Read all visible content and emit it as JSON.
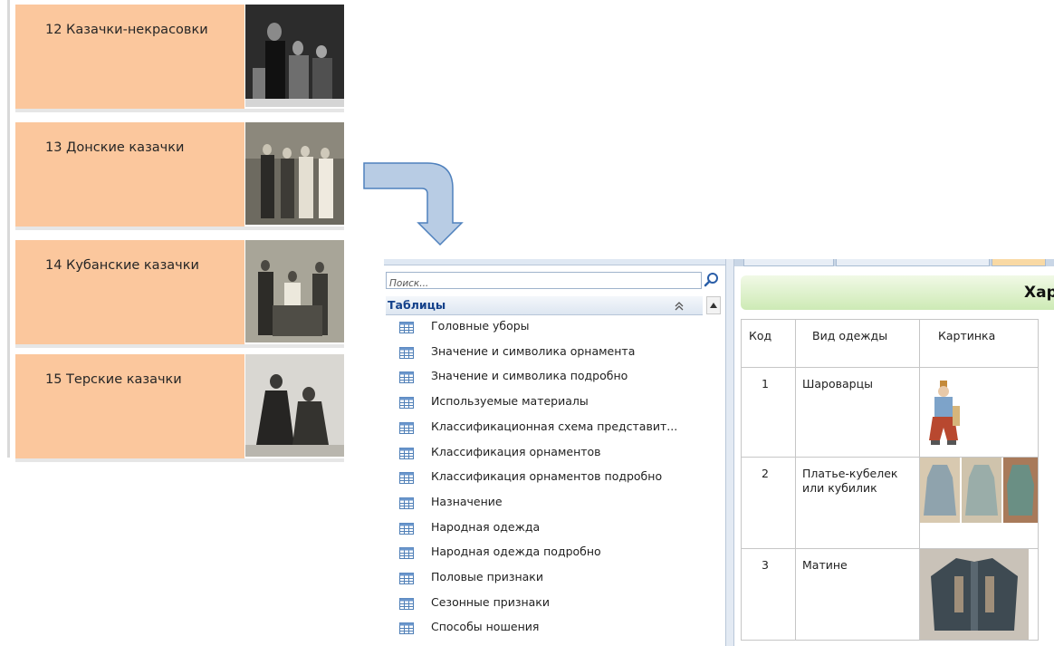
{
  "records": [
    {
      "label": "12 Казачки-некрасовки"
    },
    {
      "label": "13 Донские казачки"
    },
    {
      "label": "14 Кубанские казачки"
    },
    {
      "label": "15 Терские казачки"
    }
  ],
  "nav": {
    "search_placeholder": "Поиск...",
    "group_title": "Таблицы",
    "items": [
      "Головные уборы",
      "Значение и символика орнамента",
      "Значение и символика подробно",
      "Используемые материалы",
      "Классификационная схема представит...",
      "Классификация орнаментов",
      "Классификация орнаментов подробно",
      "Назначение",
      "Народная одежда",
      "Народная одежда подробно",
      "Половые признаки",
      "Сезонные признаки",
      "Способы ношения"
    ]
  },
  "form": {
    "title": "Хар",
    "columns": [
      "Код",
      "Вид одежды",
      "Картинка"
    ],
    "rows": [
      {
        "code": "1",
        "type": "Шароварцы"
      },
      {
        "code": "2",
        "type": "Платье-кубелек\nили кубилик"
      },
      {
        "code": "3",
        "type": "Матине"
      }
    ]
  },
  "colors": {
    "record_label_bg": "#fbc79d",
    "nav_group_title": "#15428b",
    "header_gradient_top": "#f1f9e6",
    "header_gradient_bottom": "#cdeab5",
    "arrow_fill": "#b8cce4",
    "arrow_stroke": "#4f81bd"
  },
  "icons": {
    "table_item": "table-icon",
    "search": "search-icon",
    "collapse": "double-chevron-up-icon",
    "scroll": "scroll-up-arrow-icon",
    "arrow": "bent-arrow-down-icon"
  }
}
